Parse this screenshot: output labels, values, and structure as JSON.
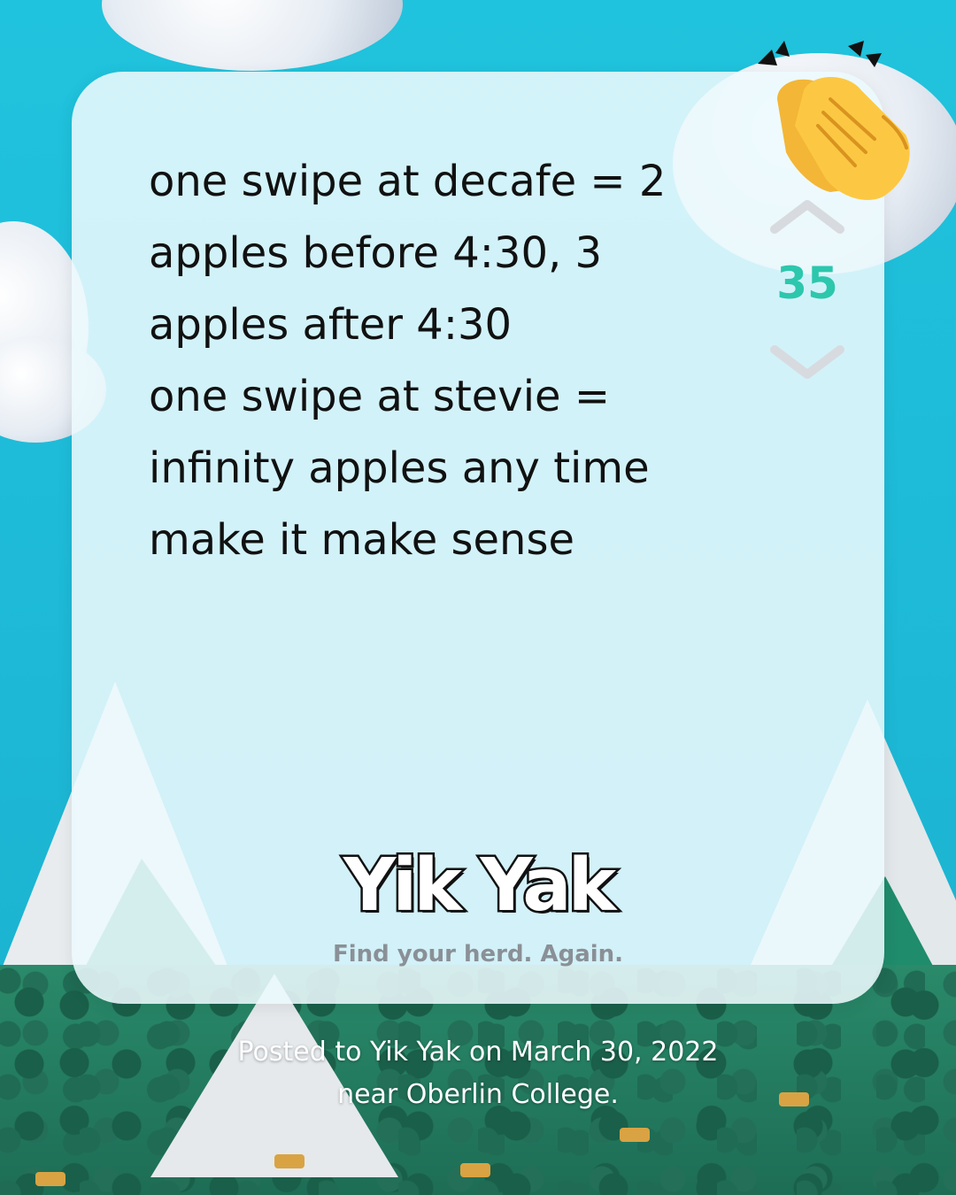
{
  "post": {
    "text": "one swipe at decafe = 2\napples before 4:30, 3\napples after 4:30\none swipe at stevie =\ninfinity apples any time\nmake it make sense",
    "vote_count": "35"
  },
  "branding": {
    "logo_text": "Yik Yak",
    "tagline": "Find your herd. Again."
  },
  "caption": {
    "line1": "Posted to Yik Yak on March 30, 2022",
    "line2": "near Oberlin College."
  },
  "icons": {
    "upvote": "chevron-up-icon",
    "downvote": "chevron-down-icon",
    "reaction": "clapping-hands-icon"
  },
  "colors": {
    "background": "#1fbfd8",
    "card": "#ecf9fd",
    "vote_count": "#2cc7ad",
    "vote_arrows": "#d7dbdf",
    "tagline": "#8a9096"
  }
}
